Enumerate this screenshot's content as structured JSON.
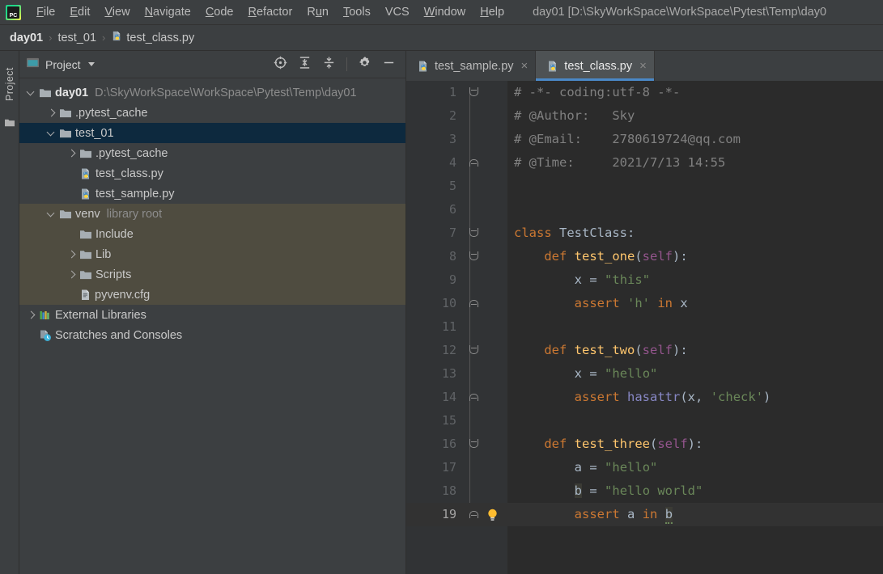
{
  "window": {
    "title": "day01 [D:\\SkyWorkSpace\\WorkSpace\\Pytest\\Temp\\day0",
    "logo_text": "PC"
  },
  "menubar": {
    "items": [
      {
        "label": "File",
        "mnemonic": "F"
      },
      {
        "label": "Edit",
        "mnemonic": "E"
      },
      {
        "label": "View",
        "mnemonic": "V"
      },
      {
        "label": "Navigate",
        "mnemonic": "N"
      },
      {
        "label": "Code",
        "mnemonic": "C"
      },
      {
        "label": "Refactor",
        "mnemonic": "R"
      },
      {
        "label": "Run",
        "mnemonic": "u"
      },
      {
        "label": "Tools",
        "mnemonic": "T"
      },
      {
        "label": "VCS",
        "mnemonic": ""
      },
      {
        "label": "Window",
        "mnemonic": "W"
      },
      {
        "label": "Help",
        "mnemonic": "H"
      }
    ]
  },
  "breadcrumb": {
    "sep": "›",
    "items": [
      {
        "label": "day01",
        "icon": "",
        "bold": true
      },
      {
        "label": "test_01",
        "icon": "",
        "bold": false
      },
      {
        "label": "test_class.py",
        "icon": "python-file-icon",
        "bold": false
      }
    ]
  },
  "toolwindow_stripe": {
    "label": "Project",
    "icon": "folder-icon"
  },
  "project_panel": {
    "title": "Project",
    "title_icon": "project-view-icon",
    "tools": [
      {
        "name": "select-opened-file-icon",
        "tooltip": "Select Opened File"
      },
      {
        "name": "expand-all-icon",
        "tooltip": "Expand All"
      },
      {
        "name": "collapse-all-icon",
        "tooltip": "Collapse All"
      },
      {
        "name": "settings-gear-icon",
        "tooltip": "Settings"
      },
      {
        "name": "hide-icon",
        "tooltip": "Hide"
      }
    ],
    "tree": [
      {
        "label": "day01",
        "note": "D:\\SkyWorkSpace\\WorkSpace\\Pytest\\Temp\\day01",
        "icon": "folder-icon",
        "indent": 0,
        "arrow": "open",
        "bold": true,
        "state": "normal"
      },
      {
        "label": ".pytest_cache",
        "note": "",
        "icon": "folder-icon",
        "indent": 1,
        "arrow": "closed",
        "bold": false,
        "state": "normal"
      },
      {
        "label": "test_01",
        "note": "",
        "icon": "folder-icon",
        "indent": 1,
        "arrow": "open",
        "bold": false,
        "state": "selected"
      },
      {
        "label": ".pytest_cache",
        "note": "",
        "icon": "folder-icon",
        "indent": 2,
        "arrow": "closed",
        "bold": false,
        "state": "normal"
      },
      {
        "label": "test_class.py",
        "note": "",
        "icon": "python-file-icon",
        "indent": 2,
        "arrow": "none",
        "bold": false,
        "state": "normal"
      },
      {
        "label": "test_sample.py",
        "note": "",
        "icon": "python-file-icon",
        "indent": 2,
        "arrow": "none",
        "bold": false,
        "state": "normal"
      },
      {
        "label": "venv",
        "note": "library root",
        "icon": "folder-icon",
        "indent": 1,
        "arrow": "open",
        "bold": false,
        "state": "band"
      },
      {
        "label": "Include",
        "note": "",
        "icon": "folder-icon",
        "indent": 2,
        "arrow": "none",
        "bold": false,
        "state": "band"
      },
      {
        "label": "Lib",
        "note": "",
        "icon": "folder-icon",
        "indent": 2,
        "arrow": "closed",
        "bold": false,
        "state": "band"
      },
      {
        "label": "Scripts",
        "note": "",
        "icon": "folder-icon",
        "indent": 2,
        "arrow": "closed",
        "bold": false,
        "state": "band"
      },
      {
        "label": "pyvenv.cfg",
        "note": "",
        "icon": "config-file-icon",
        "indent": 2,
        "arrow": "none",
        "bold": false,
        "state": "band"
      },
      {
        "label": "External Libraries",
        "note": "",
        "icon": "libraries-icon",
        "indent": 0,
        "arrow": "closed",
        "bold": false,
        "state": "normal"
      },
      {
        "label": "Scratches and Consoles",
        "note": "",
        "icon": "scratches-icon",
        "indent": 0,
        "arrow": "none",
        "bold": false,
        "state": "normal"
      }
    ]
  },
  "editor": {
    "tabs": [
      {
        "label": "test_sample.py",
        "icon": "python-file-icon",
        "active": false,
        "close": "×"
      },
      {
        "label": "test_class.py",
        "icon": "python-file-icon",
        "active": true,
        "close": "×"
      }
    ],
    "caret_line": 19,
    "lines": [
      {
        "n": "1",
        "fold": "exp",
        "bulb": false,
        "code": "# -*- coding:utf-8 -*-"
      },
      {
        "n": "2",
        "fold": "",
        "bulb": false,
        "code": "# @Author:   Sky"
      },
      {
        "n": "3",
        "fold": "",
        "bulb": false,
        "code": "# @Email:    2780619724@qq.com"
      },
      {
        "n": "4",
        "fold": "end",
        "bulb": false,
        "code": "# @Time:     2021/7/13 14:55"
      },
      {
        "n": "5",
        "fold": "",
        "bulb": false,
        "code": ""
      },
      {
        "n": "6",
        "fold": "",
        "bulb": false,
        "code": ""
      },
      {
        "n": "7",
        "fold": "exp",
        "bulb": false,
        "code": "class TestClass:"
      },
      {
        "n": "8",
        "fold": "exp",
        "bulb": false,
        "code": "    def test_one(self):"
      },
      {
        "n": "9",
        "fold": "",
        "bulb": false,
        "code": "        x = \"this\""
      },
      {
        "n": "10",
        "fold": "end",
        "bulb": false,
        "code": "        assert 'h' in x"
      },
      {
        "n": "11",
        "fold": "",
        "bulb": false,
        "code": ""
      },
      {
        "n": "12",
        "fold": "exp",
        "bulb": false,
        "code": "    def test_two(self):"
      },
      {
        "n": "13",
        "fold": "",
        "bulb": false,
        "code": "        x = \"hello\""
      },
      {
        "n": "14",
        "fold": "end",
        "bulb": false,
        "code": "        assert hasattr(x, 'check')"
      },
      {
        "n": "15",
        "fold": "",
        "bulb": false,
        "code": ""
      },
      {
        "n": "16",
        "fold": "exp",
        "bulb": false,
        "code": "    def test_three(self):"
      },
      {
        "n": "17",
        "fold": "",
        "bulb": false,
        "code": "        a = \"hello\""
      },
      {
        "n": "18",
        "fold": "",
        "bulb": false,
        "code": "        b = \"hello world\""
      },
      {
        "n": "19",
        "fold": "end",
        "bulb": true,
        "code": "        assert a in b"
      }
    ]
  },
  "colors": {
    "panel_bg": "#3c3f41",
    "editor_bg": "#2b2b2b",
    "gutter_bg": "#313335",
    "selection_blue": "#0d293e",
    "band_olive": "#4f4c40",
    "tab_active_bg": "#4e5254",
    "tab_underline": "#4a88c7",
    "keyword": "#cc7832",
    "function": "#ffc66d",
    "string": "#6a8759",
    "self": "#94558d",
    "builtin": "#8888c6",
    "comment": "#808080",
    "text": "#a9b7c6"
  }
}
